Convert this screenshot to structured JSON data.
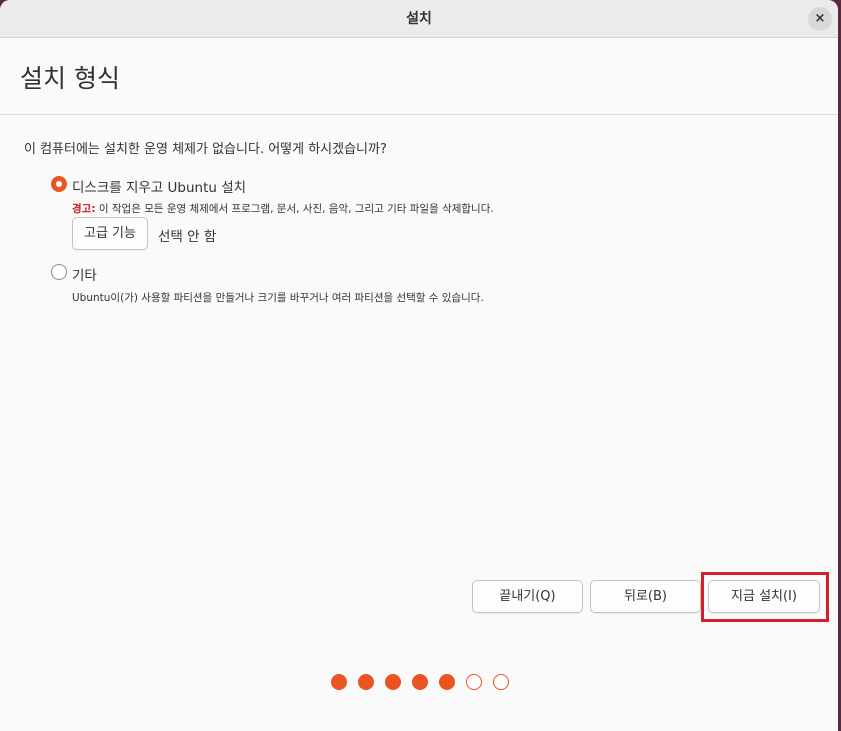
{
  "window": {
    "title": "설치",
    "close_symbol": "×"
  },
  "page": {
    "heading": "설치 형식"
  },
  "question": "이 컴퓨터에는 설치한 운영 체제가 없습니다. 어떻게 하시겠습니까?",
  "options": [
    {
      "label": "디스크를 지우고 Ubuntu 설치",
      "selected": true,
      "warning_label": "경고:",
      "description": "이 작업은 모든 운영 체제에서 프로그램, 문서, 사진, 음악, 그리고 기타 파일을 삭제합니다."
    },
    {
      "label": "기타",
      "selected": false,
      "description": "Ubuntu이(가) 사용할 파티션을 만들거나 크기를 바꾸거나 여러 파티션을 선택할 수 있습니다."
    }
  ],
  "advanced": {
    "button_label": "고급 기능",
    "status": "선택 안 함"
  },
  "footer": {
    "quit_label": "끝내기(Q)",
    "back_label": "뒤로(B)",
    "install_label": "지금 설치(I)"
  },
  "progress": {
    "total_steps": 7,
    "completed_steps": 5
  },
  "colors": {
    "accent": "#e95420",
    "warning": "#c7162b",
    "highlight_box": "#d61d2a"
  }
}
